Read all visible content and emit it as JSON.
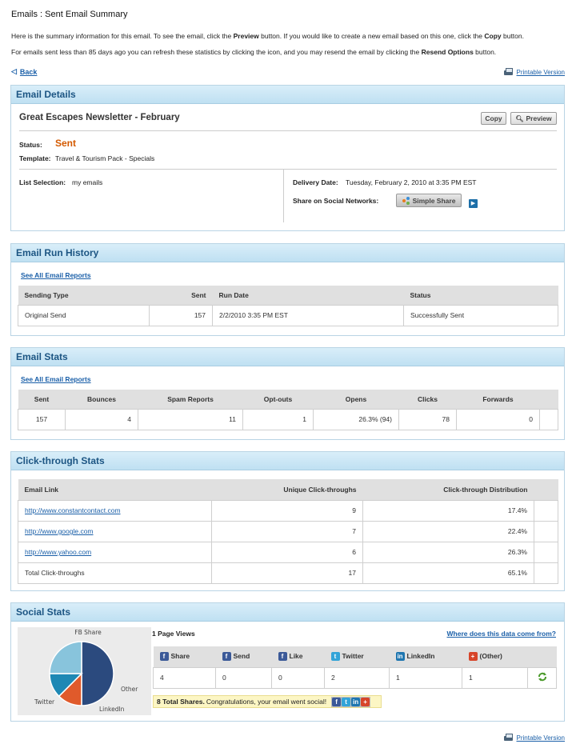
{
  "page": {
    "title": "Emails : Sent Email Summary",
    "intro1": {
      "a": "Here is the summary information for this email. To see the email, click the ",
      "b1": "Preview",
      "c": " button. If you would like to create a new email based on this one, click the ",
      "b2": "Copy",
      "d": " button."
    },
    "intro2": {
      "a": "For emails sent less than 85 days ago you can refresh these statistics by clicking the icon, and you may resend the email by clicking the ",
      "b1": "Resend Options",
      "c": " button."
    },
    "back": "Back",
    "printable": "Printable Version"
  },
  "details": {
    "heading": "Email Details",
    "email_name": "Great Escapes Newsletter - February",
    "copy_label": "Copy",
    "preview_label": "Preview",
    "status_label": "Status:",
    "status_value": "Sent",
    "template_label": "Template:",
    "template_value": "Travel & Tourism Pack - Specials",
    "list_label": "List Selection:",
    "list_value": "my emails",
    "delivery_label": "Delivery Date:",
    "delivery_value": "Tuesday, February 2, 2010 at 3:35 PM EST",
    "share_label": "Share on Social Networks:",
    "simple_share_label": "Simple Share"
  },
  "run_history": {
    "heading": "Email Run History",
    "reports_link": "See All Email Reports",
    "columns": [
      "Sending Type",
      "Sent",
      "Run Date",
      "Status"
    ],
    "rows": [
      [
        "Original Send",
        "157",
        "2/2/2010 3:35 PM EST",
        "Successfully Sent"
      ]
    ]
  },
  "stats": {
    "heading": "Email Stats",
    "reports_link": "See All Email Reports",
    "columns": [
      "Sent",
      "Bounces",
      "Spam Reports",
      "Opt-outs",
      "Opens",
      "Clicks",
      "Forwards"
    ],
    "values": [
      "157",
      "4",
      "11",
      "1",
      "26.3% (94)",
      "78",
      "0"
    ]
  },
  "clickthrough": {
    "heading": "Click-through Stats",
    "columns": [
      "Email Link",
      "Unique Click-throughs",
      "Click-through Distribution"
    ],
    "rows": [
      [
        "http://www.constantcontact.com",
        "9",
        "17.4%"
      ],
      [
        "http://www.google.com",
        "7",
        "22.4%"
      ],
      [
        "http://www.yahoo.com",
        "6",
        "26.3%"
      ]
    ],
    "total_row": [
      "Total Click-throughs",
      "17",
      "65.1%"
    ]
  },
  "social": {
    "heading": "Social Stats",
    "page_views": "1 Page Views",
    "data_link": "Where does this data come from?",
    "columns": [
      {
        "label": "Share",
        "icon": "facebook-icon"
      },
      {
        "label": "Send",
        "icon": "facebook-icon"
      },
      {
        "label": "Like",
        "icon": "facebook-icon"
      },
      {
        "label": "Twitter",
        "icon": "twitter-icon"
      },
      {
        "label": "LinkedIn",
        "icon": "linkedin-icon"
      },
      {
        "label": "(Other)",
        "icon": "plus-icon"
      }
    ],
    "values": [
      "4",
      "0",
      "0",
      "2",
      "1",
      "1"
    ],
    "total_shares": "8 Total Shares.",
    "congrats": "Congratulations, your email went social!",
    "pie": {
      "labels": [
        "FB Share",
        "Other",
        "LinkedIn",
        "Twitter"
      ],
      "values": [
        4,
        1,
        1,
        2
      ],
      "colors": [
        "#2b4a7e",
        "#e05a2b",
        "#1e88b4",
        "#88c4dc"
      ]
    }
  },
  "colors": {
    "accent": "#1c5583",
    "status_sent": "#d45a00",
    "link": "#1a5fa8"
  }
}
